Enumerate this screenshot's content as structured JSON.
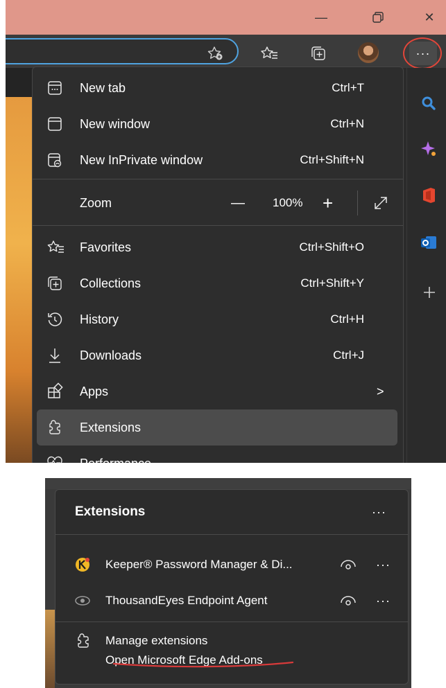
{
  "window_controls": {
    "minimize": "—",
    "restore": "❐",
    "close": "✕"
  },
  "toolbar": {
    "more_button": "···"
  },
  "menu": {
    "items": [
      {
        "label": "New tab",
        "shortcut": "Ctrl+T",
        "icon": "new-tab-icon"
      },
      {
        "label": "New window",
        "shortcut": "Ctrl+N",
        "icon": "new-window-icon"
      },
      {
        "label": "New InPrivate window",
        "shortcut": "Ctrl+Shift+N",
        "icon": "inprivate-icon"
      }
    ],
    "zoom": {
      "label": "Zoom",
      "minus": "—",
      "value": "100%",
      "plus": "+"
    },
    "items2": [
      {
        "label": "Favorites",
        "shortcut": "Ctrl+Shift+O",
        "icon": "favorites-icon"
      },
      {
        "label": "Collections",
        "shortcut": "Ctrl+Shift+Y",
        "icon": "collections-icon"
      },
      {
        "label": "History",
        "shortcut": "Ctrl+H",
        "icon": "history-icon"
      },
      {
        "label": "Downloads",
        "shortcut": "Ctrl+J",
        "icon": "downloads-icon"
      },
      {
        "label": "Apps",
        "shortcut": "",
        "icon": "apps-icon"
      },
      {
        "label": "Extensions",
        "shortcut": "",
        "icon": "extensions-icon"
      },
      {
        "label": "Performance",
        "shortcut": "",
        "icon": "performance-icon"
      }
    ],
    "apps_chevron": ">"
  },
  "extensions_panel": {
    "title": "Extensions",
    "more": "···",
    "items": [
      {
        "name": "Keeper® Password Manager & Di...",
        "more": "···"
      },
      {
        "name": "ThousandEyes Endpoint Agent",
        "more": "···"
      }
    ],
    "manage": "Manage extensions",
    "open_addons": "Open Microsoft Edge Add-ons"
  },
  "colors": {
    "titlebar": "#e0978a",
    "menu_bg": "#2d2d2d",
    "highlight_circle": "#e2463a",
    "underline": "#d83a3a",
    "address_outline": "#4fa3e0"
  }
}
